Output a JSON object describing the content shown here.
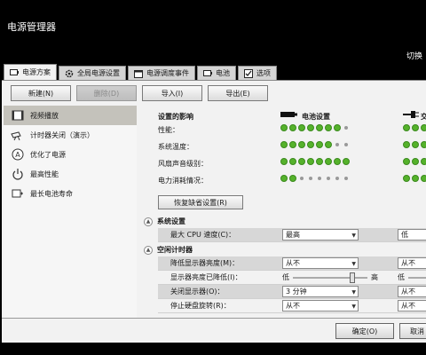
{
  "window": {
    "title": "电源管理器",
    "switch_text": "切换"
  },
  "tabs": [
    {
      "label": "电源方案",
      "icon": "battery-plug-icon"
    },
    {
      "label": "全局电源设置",
      "icon": "gear-icon"
    },
    {
      "label": "电源调度事件",
      "icon": "calendar-icon"
    },
    {
      "label": "电池",
      "icon": "battery-icon"
    },
    {
      "label": "选项",
      "icon": "checkbox-icon"
    }
  ],
  "toolbar": {
    "new": "新建(N)",
    "delete": "删除(D)",
    "import": "导入(I)",
    "export": "导出(E)"
  },
  "sidebar": {
    "items": [
      {
        "label": "视频播放",
        "icon": "film-icon"
      },
      {
        "label": "计时器关闭（演示）",
        "icon": "projector-icon"
      },
      {
        "label": "优化了电源",
        "icon": "a-circle-icon"
      },
      {
        "label": "最高性能",
        "icon": "power-icon"
      },
      {
        "label": "最长电池寿命",
        "icon": "battery-plus-icon"
      }
    ]
  },
  "impact": {
    "header": "设置的影响",
    "battery_header": "电池设置",
    "ac_header": "交",
    "rows": [
      {
        "label": "性能：",
        "battery_level": 7,
        "ac_level": 3
      },
      {
        "label": "系统温度：",
        "battery_level": 6,
        "ac_level": 3
      },
      {
        "label": "风扇声音级别：",
        "battery_level": 8,
        "ac_level": 3
      },
      {
        "label": "电力消耗情况：",
        "battery_level": 2,
        "ac_level": 3
      }
    ],
    "restore": "恢复缺省设置(R)"
  },
  "system_settings": {
    "title": "系统设置",
    "cpu_label": "最大 CPU 速度(C)：",
    "cpu_value": "最高",
    "cpu_ac_value": "低"
  },
  "idle_timer": {
    "title": "空闲计时器",
    "rows": [
      {
        "label": "降低显示器亮度(M)：",
        "value": "从不",
        "ac_value": "从不"
      },
      {
        "label": "显示器亮度已降低(I)：",
        "low": "低",
        "high": "高",
        "ac_low": "低",
        "brightness": 0.8
      },
      {
        "label": "关闭显示器(O)：",
        "value": "3 分钟",
        "ac_value": "从不"
      },
      {
        "label": "停止硬盘旋转(R)：",
        "value": "从不",
        "ac_value": "从不"
      }
    ]
  },
  "buttons": {
    "ok": "确定(O)",
    "cancel": "取消"
  }
}
